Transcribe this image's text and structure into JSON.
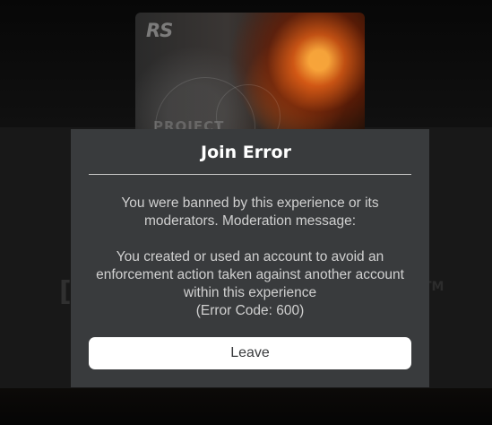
{
  "background": {
    "thumbnail_logo": "RS",
    "thumbnail_text": "PROJECT",
    "left_glyph": "[",
    "right_glyph": "TM"
  },
  "dialog": {
    "title": "Join Error",
    "ban_message": "You were banned by this experience or its moderators. Moderation message:",
    "moderation_reason": "You created or used an account to avoid an enforcement action taken against another account within this experience",
    "error_code": "(Error Code: 600)",
    "leave_label": "Leave"
  },
  "colors": {
    "dialog_background": "#393b3d",
    "button_background": "#ffffff",
    "title_text": "#ffffff",
    "body_text": "#d0d0d0",
    "divider": "#c9c9c9"
  }
}
